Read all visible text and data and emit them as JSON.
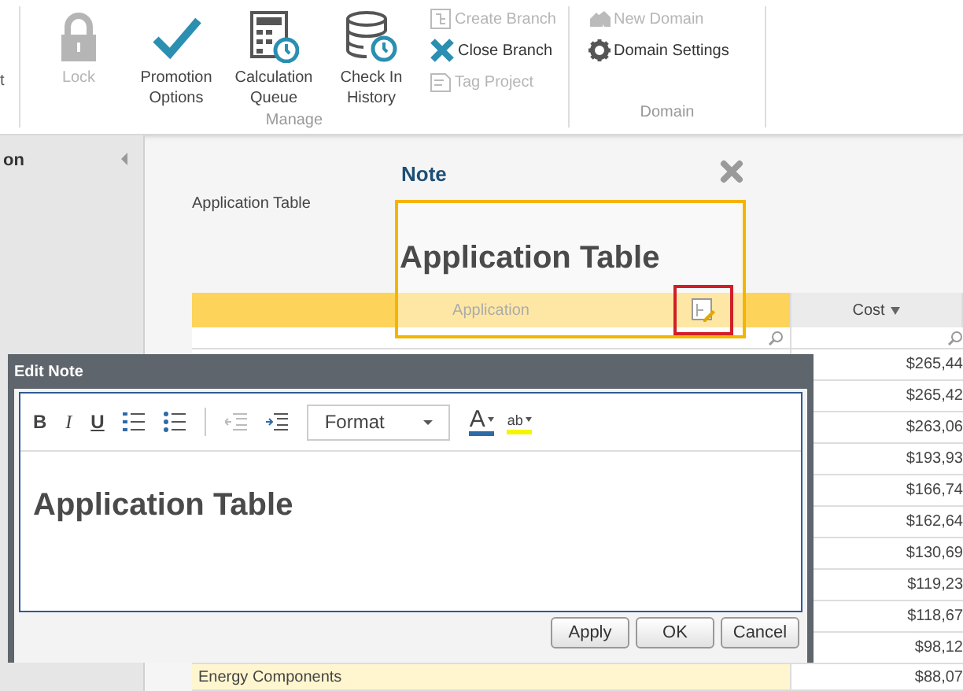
{
  "ribbon": {
    "cut_label": "t",
    "groups": [
      {
        "label": "Manage",
        "large": [
          {
            "label": "Lock",
            "disabled": true
          },
          {
            "label": "Promotion Options",
            "disabled": false
          },
          {
            "label": "Calculation Queue",
            "disabled": false
          },
          {
            "label": "Check In History",
            "disabled": false
          }
        ],
        "small": [
          {
            "label": "Create Branch",
            "disabled": true
          },
          {
            "label": "Close Branch",
            "disabled": false
          },
          {
            "label": "Tag Project",
            "disabled": true
          }
        ]
      },
      {
        "label": "Domain",
        "small": [
          {
            "label": "New Domain",
            "disabled": true
          },
          {
            "label": "Domain Settings",
            "disabled": false
          }
        ]
      }
    ]
  },
  "sidebar": {
    "title": "on"
  },
  "page": {
    "title": "Application Table"
  },
  "table": {
    "columns": [
      {
        "label": "Application",
        "sorted": false
      },
      {
        "label": "Cost",
        "sorted": true
      }
    ],
    "rows": [
      {
        "application": "",
        "cost": "$265,44"
      },
      {
        "application": "",
        "cost": "$265,42"
      },
      {
        "application": "",
        "cost": "$263,06"
      },
      {
        "application": "",
        "cost": "$193,93"
      },
      {
        "application": "",
        "cost": "$166,74"
      },
      {
        "application": "",
        "cost": "$162,64"
      },
      {
        "application": "",
        "cost": "$130,69"
      },
      {
        "application": "",
        "cost": "$119,23"
      },
      {
        "application": "",
        "cost": "$118,67"
      },
      {
        "application": "",
        "cost": "$98,12"
      },
      {
        "application": "Energy Components",
        "cost": "$88,07"
      }
    ]
  },
  "note": {
    "title": "Note",
    "content": "Application Table"
  },
  "edit_note": {
    "title": "Edit Note",
    "toolbar": {
      "bold": "B",
      "italic": "I",
      "underline": "U",
      "format": "Format",
      "font_color": "A",
      "highlight": "ab"
    },
    "content": "Application Table",
    "buttons": [
      "Apply",
      "OK",
      "Cancel"
    ]
  }
}
